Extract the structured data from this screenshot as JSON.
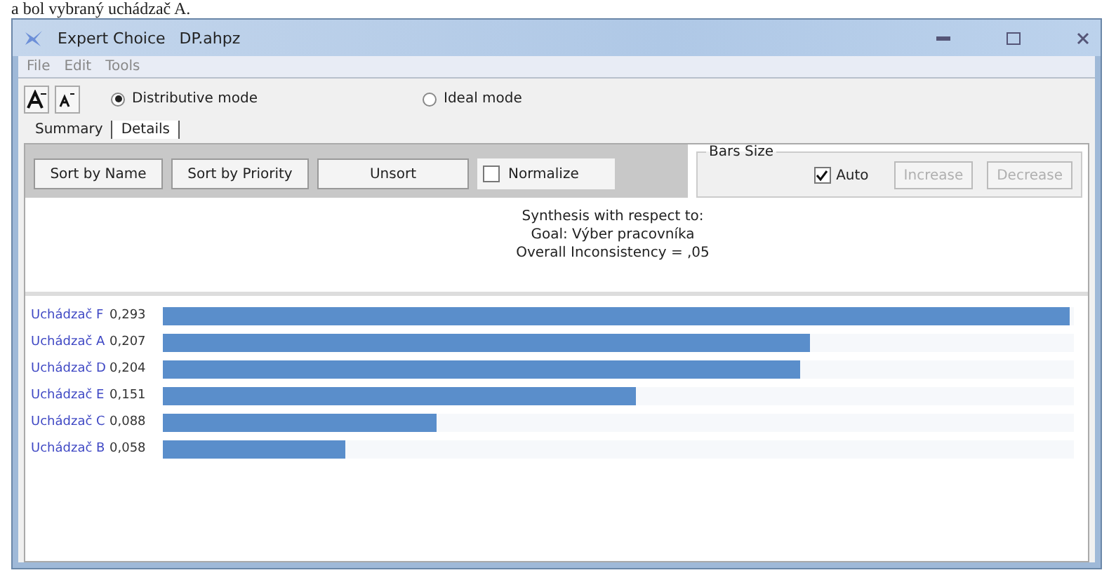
{
  "document_text": "a bol vybraný uchádzač A.",
  "window": {
    "title": "Expert Choice",
    "file": "DP.ahpz"
  },
  "menu": [
    "File",
    "Edit",
    "Tools"
  ],
  "modes": [
    {
      "label": "Distributive mode",
      "selected": true
    },
    {
      "label": "Ideal mode",
      "selected": false
    }
  ],
  "tabs": [
    {
      "label": "Summary",
      "selected": false
    },
    {
      "label": "Details",
      "selected": true
    }
  ],
  "buttons": [
    "Sort by Name",
    "Sort by Priority",
    "Unsort"
  ],
  "normalize": {
    "label": "Normalize",
    "checked": false
  },
  "bars_size": {
    "title": "Bars Size",
    "auto": {
      "label": "Auto",
      "checked": true
    },
    "buttons": [
      {
        "label": "Increase",
        "disabled": true
      },
      {
        "label": "Decrease",
        "disabled": true
      }
    ]
  },
  "synthesis": [
    "Synthesis with respect to:",
    "Goal: Výber pracovníka",
    "Overall Inconsistency = ,05"
  ],
  "results": [
    {
      "name": "Uchádzač F",
      "value": "0,293",
      "level": 0.995
    },
    {
      "name": "Uchádzač A",
      "value": "0,207",
      "level": 0.71
    },
    {
      "name": "Uchádzač D",
      "value": "0,204",
      "level": 0.7
    },
    {
      "name": "Uchádzač E",
      "value": "0,151",
      "level": 0.52
    },
    {
      "name": "Uchádzač C",
      "value": "0,088",
      "level": 0.3
    },
    {
      "name": "Uchádzač B",
      "value": "0,058",
      "level": 0.2
    }
  ]
}
